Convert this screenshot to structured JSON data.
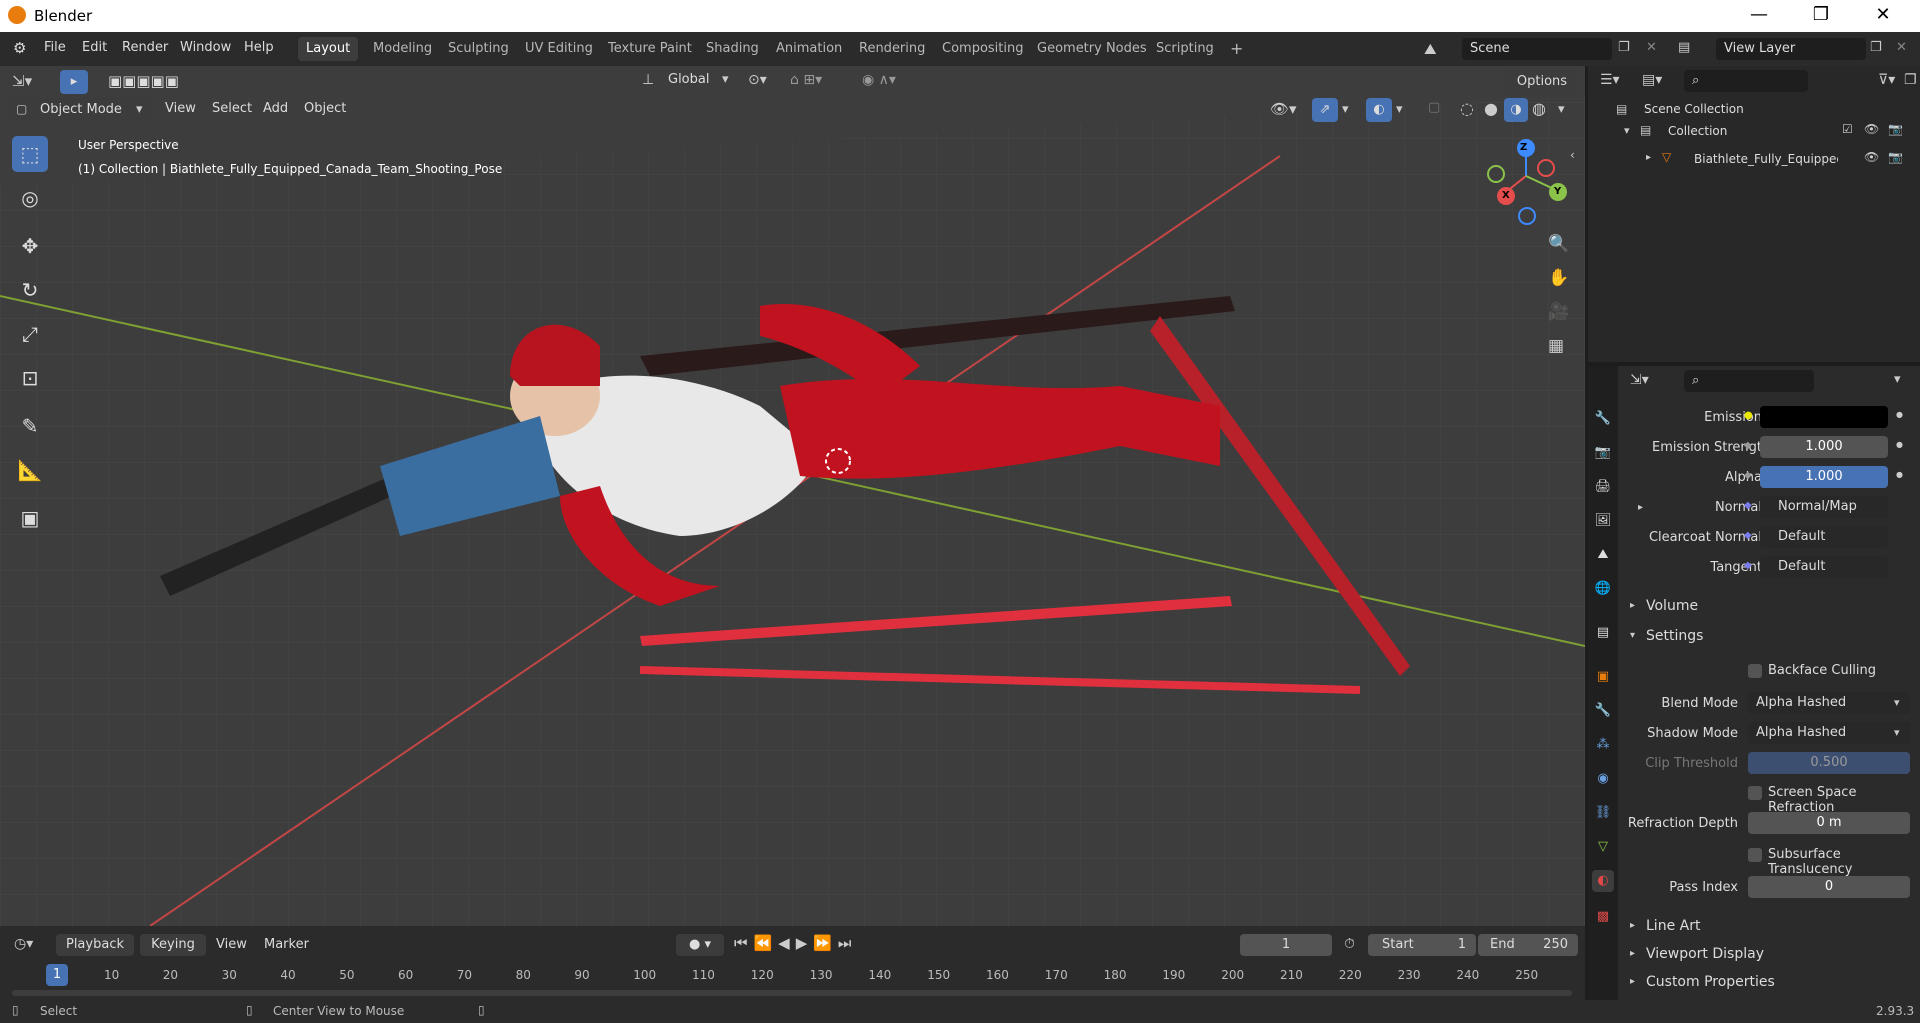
{
  "window": {
    "title": "Blender",
    "minimize": "—",
    "maximize": "❐",
    "close": "✕"
  },
  "menu": {
    "items": [
      "File",
      "Edit",
      "Render",
      "Window",
      "Help"
    ]
  },
  "workspaces": [
    "Layout",
    "Modeling",
    "Sculpting",
    "UV Editing",
    "Texture Paint",
    "Shading",
    "Animation",
    "Rendering",
    "Compositing",
    "Geometry Nodes",
    "Scripting"
  ],
  "active_workspace": "Layout",
  "scene": {
    "name": "Scene",
    "view_layer": "View Layer"
  },
  "header3d": {
    "orientation": "Global",
    "options": "Options",
    "mode": "Object Mode",
    "view": "View",
    "select": "Select",
    "add": "Add",
    "object": "Object"
  },
  "overlay": {
    "perspective": "User Perspective",
    "collection_info": "(1) Collection | Biathlete_Fully_Equipped_Canada_Team_Shooting_Pose"
  },
  "gizmo": {
    "x": "X",
    "y": "Y",
    "z": "Z"
  },
  "colors": {
    "accent": "#4772b3",
    "x_axis": "#e54d4d",
    "y_axis": "#8bc34a",
    "z_axis": "#3d8bff",
    "panel": "#2b2b2b",
    "viewport": "#3d3d3d"
  },
  "outliner": {
    "scene_collection": "Scene Collection",
    "collection": "Collection",
    "object": "Biathlete_Fully_Equippec"
  },
  "props": {
    "emission": "Emission",
    "emission_strength_label": "Emission Strengt",
    "emission_strength": "1.000",
    "alpha_label": "Alpha",
    "alpha": "1.000",
    "normal_label": "Normal",
    "normal_value": "Normal/Map",
    "clearcoat_label": "Clearcoat Normal",
    "clearcoat_value": "Default",
    "tangent_label": "Tangent",
    "tangent_value": "Default",
    "volume": "Volume",
    "settings": "Settings",
    "backface": "Backface Culling",
    "blend_label": "Blend Mode",
    "blend_value": "Alpha Hashed",
    "shadow_label": "Shadow Mode",
    "shadow_value": "Alpha Hashed",
    "clip_label": "Clip Threshold",
    "clip_value": "0.500",
    "ssr": "Screen Space Refraction",
    "refr_label": "Refraction Depth",
    "refr_value": "0 m",
    "sss": "Subsurface Translucency",
    "pass_label": "Pass Index",
    "pass_value": "0",
    "line_art": "Line Art",
    "viewport_display": "Viewport Display",
    "custom_props": "Custom Properties"
  },
  "timeline": {
    "playback": "Playback",
    "keying": "Keying",
    "view": "View",
    "marker": "Marker",
    "current_frame": "1",
    "start_label": "Start",
    "start": "1",
    "end_label": "End",
    "end": "250",
    "ticks": [
      "10",
      "20",
      "30",
      "40",
      "50",
      "60",
      "70",
      "80",
      "90",
      "100",
      "110",
      "120",
      "130",
      "140",
      "150",
      "160",
      "170",
      "180",
      "190",
      "200",
      "210",
      "220",
      "230",
      "240",
      "250"
    ],
    "playhead": "1"
  },
  "status": {
    "select": "Select",
    "center": "Center View to Mouse",
    "version": "2.93.3"
  }
}
